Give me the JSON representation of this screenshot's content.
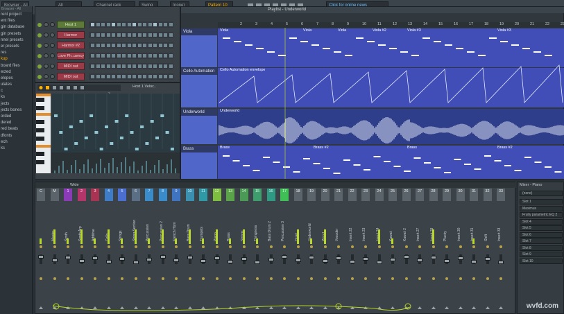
{
  "topbar": {
    "all": "All",
    "browser_all": "Browser - All",
    "channel_rack": "Channel rack",
    "swing": "Swing",
    "pattern": "Pattern 10",
    "none": "(none)",
    "online_news": "Click for online news"
  },
  "browser": {
    "header": "Browser - All",
    "items": [
      "rent project",
      "ent files",
      "gin database",
      "gin presets",
      "nnel presets",
      "er presets",
      "res",
      "kup",
      "board files",
      "ected",
      "elopes",
      "ulates",
      "c",
      "ks",
      "jects",
      "jects bones",
      "orded",
      "dered",
      "red beats",
      "dfonts",
      "ech",
      "ks"
    ]
  },
  "channel_rack": {
    "title": "Channel rack",
    "channels": [
      {
        "name": "Host 1",
        "color": "green"
      },
      {
        "name": "Harmor",
        "color": "red"
      },
      {
        "name": "Harmor #2",
        "color": "red"
      },
      {
        "name": "Love Ph..uency",
        "color": "red"
      },
      {
        "name": "MIDI out",
        "color": "red"
      },
      {
        "name": "MIDI out",
        "color": "red"
      }
    ]
  },
  "piano_roll": {
    "title": "Host 1 Veloc..",
    "bar_marker": "3"
  },
  "playlist": {
    "title": "Playlist - Underworld",
    "bar_numbers": [
      "2",
      "3",
      "4",
      "5",
      "6",
      "7",
      "8",
      "9",
      "10",
      "11",
      "12",
      "13",
      "14",
      "15",
      "16",
      "17",
      "18",
      "19",
      "20",
      "21",
      "22",
      "23",
      "24"
    ],
    "tracks": [
      {
        "name": "Viola",
        "clips": [
          "Viola",
          "Viola",
          "Viola",
          "Viola #2",
          "Viola #3",
          "Viola #3"
        ]
      },
      {
        "name": "Cello Automation",
        "clips": [
          "Cello Automation envelope"
        ]
      },
      {
        "name": "Underworld",
        "clips": [
          "Underworld"
        ]
      },
      {
        "name": "Brass",
        "clips": [
          "Brass",
          "Brass #2",
          "Brass",
          "Brass #2"
        ]
      }
    ]
  },
  "mixer": {
    "title": "Wide",
    "channels": [
      {
        "num": "C",
        "label": "",
        "color": "#5a646a"
      },
      {
        "num": "M",
        "label": "Master",
        "color": "#5a646a"
      },
      {
        "num": "1",
        "label": "Synth",
        "color": "#8c3bb6"
      },
      {
        "num": "2",
        "label": "Synth Arp",
        "color": "#b4356a"
      },
      {
        "num": "3",
        "label": "Additive",
        "color": "#a83352"
      },
      {
        "num": "4",
        "label": "Cello",
        "color": "#3f7cc7"
      },
      {
        "num": "5",
        "label": "Strings",
        "color": "#4a6fd1"
      },
      {
        "num": "6",
        "label": "String Section",
        "color": "#5a6f86"
      },
      {
        "num": "7",
        "label": "Percussion",
        "color": "#3a8bc9"
      },
      {
        "num": "8",
        "label": "Percussion 2",
        "color": "#3a8bc9"
      },
      {
        "num": "9",
        "label": "French Horn",
        "color": "#3f74c3"
      },
      {
        "num": "10",
        "label": "Bass Drum",
        "color": "#3990b0"
      },
      {
        "num": "11",
        "label": "Trumpets",
        "color": "#2e9aa6"
      },
      {
        "num": "12",
        "label": "Piano",
        "color": "#7fbf3f"
      },
      {
        "num": "13",
        "label": "Brass",
        "color": "#5aa348"
      },
      {
        "num": "14",
        "label": "Strings",
        "color": "#4a9a56"
      },
      {
        "num": "15",
        "label": "Thingness",
        "color": "#3d9d6c"
      },
      {
        "num": "16",
        "label": "Bass Drum 2",
        "color": "#2f9a84"
      },
      {
        "num": "17",
        "label": "Percussion 3",
        "color": "#3fbf56"
      },
      {
        "num": "18",
        "label": "Quiet",
        "color": "#5a646a"
      },
      {
        "num": "19",
        "label": "Underworld",
        "color": "#5a646a"
      },
      {
        "num": "20",
        "label": "Wood",
        "color": "#5a646a"
      },
      {
        "num": "21",
        "label": "Vocoder",
        "color": "#5a646a"
      },
      {
        "num": "22",
        "label": "Insert 22",
        "color": "#5a646a"
      },
      {
        "num": "23",
        "label": "Insert 23",
        "color": "#5a646a"
      },
      {
        "num": "24",
        "label": "Insert 24",
        "color": "#5a646a"
      },
      {
        "num": "25",
        "label": "Kawaii",
        "color": "#5a646a"
      },
      {
        "num": "26",
        "label": "Kawaii 2",
        "color": "#5a646a"
      },
      {
        "num": "27",
        "label": "Insert 27",
        "color": "#5a646a"
      },
      {
        "num": "28",
        "label": "Insert 28",
        "color": "#5a646a"
      },
      {
        "num": "29",
        "label": "Plucky",
        "color": "#5a646a"
      },
      {
        "num": "30",
        "label": "Insert 30",
        "color": "#5a646a"
      },
      {
        "num": "31",
        "label": "Insert 31",
        "color": "#5a646a"
      },
      {
        "num": "32",
        "label": "Shift",
        "color": "#5a646a"
      },
      {
        "num": "33",
        "label": "Insert 33",
        "color": "#5a646a"
      }
    ]
  },
  "mixer_panel": {
    "title": "Mixer - Piano",
    "preset": "(none)",
    "slots": [
      "Slot 1",
      "Maximus",
      "Fruity parametric EQ 2",
      "Slot 4",
      "Slot 5",
      "Slot 6",
      "Slot 7",
      "Slot 8",
      "Slot 9",
      "Slot 10"
    ]
  },
  "watermark": "wvfd.com",
  "colors": {
    "playlist_track": "#414eb8",
    "playlist_icon": "#5067c9",
    "meter": "#b9d62b",
    "accent": "#ffb000"
  }
}
